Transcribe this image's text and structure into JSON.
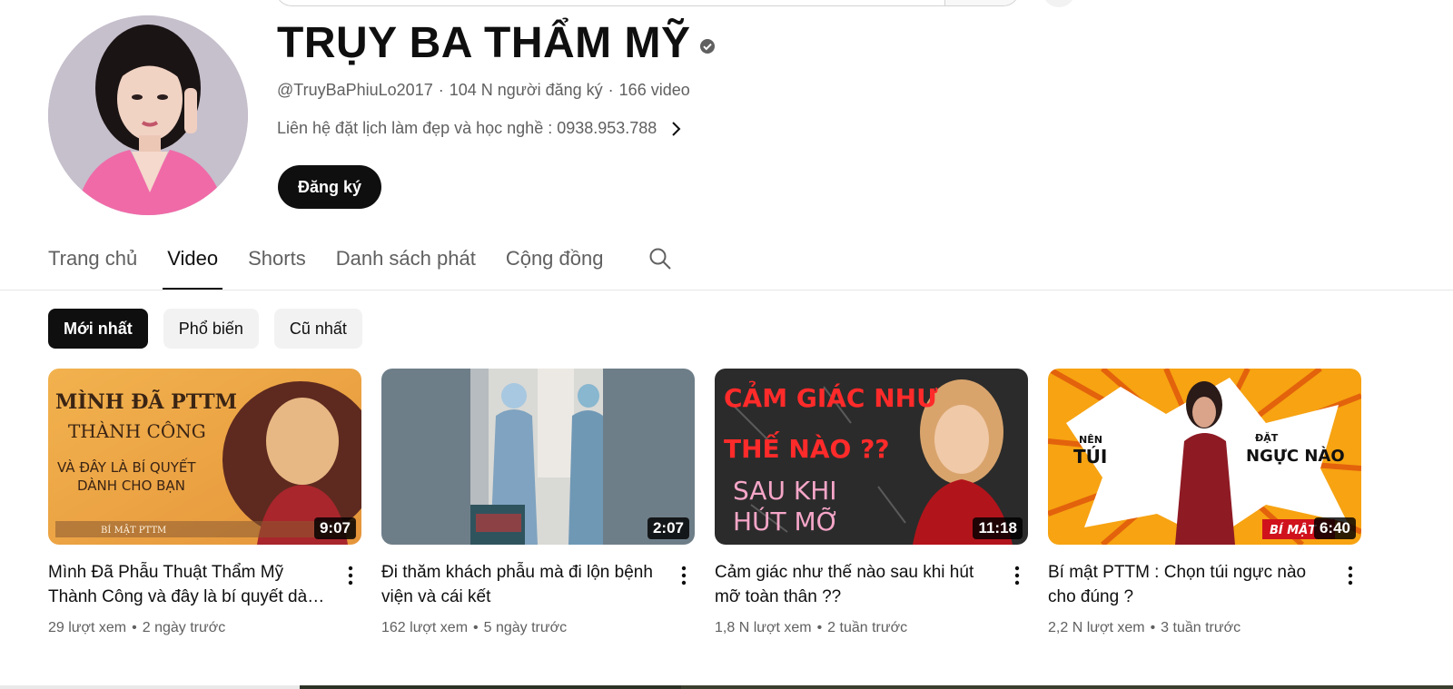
{
  "channel": {
    "name": "TRỤY BA THẨM MỸ",
    "handle": "@TruyBaPhiuLo2017",
    "subscribers": "104 N người đăng ký",
    "video_count": "166 video",
    "description": "Liên hệ đặt lịch làm đẹp và học nghề : 0938.953.788",
    "subscribe_label": "Đăng ký"
  },
  "tabs": [
    {
      "label": "Trang chủ",
      "active": false
    },
    {
      "label": "Video",
      "active": true
    },
    {
      "label": "Shorts",
      "active": false
    },
    {
      "label": "Danh sách phát",
      "active": false
    },
    {
      "label": "Cộng đồng",
      "active": false
    }
  ],
  "chips": [
    {
      "label": "Mới nhất",
      "active": true
    },
    {
      "label": "Phổ biến",
      "active": false
    },
    {
      "label": "Cũ nhất",
      "active": false
    }
  ],
  "videos": [
    {
      "title": "Mình Đã Phẫu Thuật Thẩm Mỹ Thành Công và đây là bí quyết dành cho bạn",
      "duration": "9:07",
      "views": "29 lượt xem",
      "age": "2 ngày trước",
      "thumb_text": [
        "MÌNH ĐÃ PTTM",
        "THÀNH CÔNG",
        "VÀ ĐÂY LÀ BÍ QUYẾT",
        "DÀNH CHO BẠN",
        "BÍ MẬT PTTM"
      ]
    },
    {
      "title": "Đi thăm khách phẫu mà đi lộn bệnh viện và cái kết",
      "duration": "2:07",
      "views": "162 lượt xem",
      "age": "5 ngày trước",
      "thumb_text": []
    },
    {
      "title": "Cảm giác như thế nào sau khi hút mỡ toàn thân ??",
      "duration": "11:18",
      "views": "1,8 N lượt xem",
      "age": "2 tuần trước",
      "thumb_text": [
        "CẢM GIÁC NHƯ",
        "THẾ NÀO ??",
        "SAU KHI",
        "HÚT MỠ"
      ]
    },
    {
      "title": "Bí mật PTTM : Chọn túi ngực nào cho đúng ?",
      "duration": "6:40",
      "views": "2,2 N lượt xem",
      "age": "3 tuần trước",
      "thumb_text": [
        "NÊN",
        "TÚI",
        "ĐẶT",
        "NGỰC NÀO",
        "BÍ MẬT"
      ]
    }
  ],
  "colors": {
    "text_primary": "#0f0f0f",
    "text_secondary": "#606060",
    "chip_bg": "#f2f2f2"
  }
}
